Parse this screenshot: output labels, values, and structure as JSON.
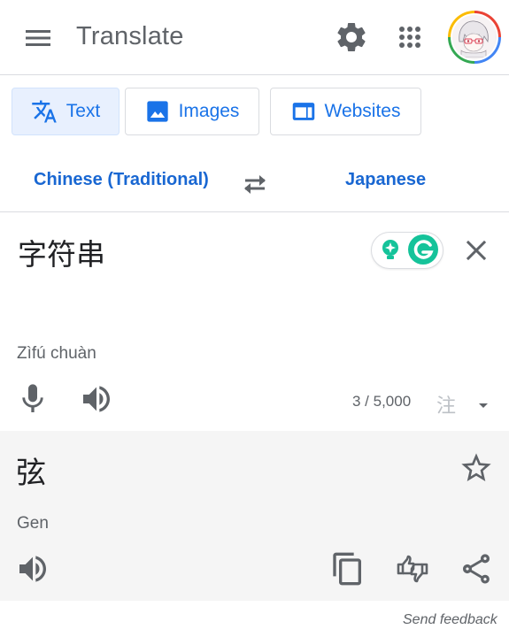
{
  "header": {
    "title": "Translate",
    "icons": {
      "menu": "menu-icon",
      "settings": "gear-icon",
      "apps": "apps-grid-icon",
      "avatar": "account-avatar"
    }
  },
  "modes": {
    "tabs": [
      {
        "label": "Text",
        "icon": "translate-icon",
        "active": true
      },
      {
        "label": "Images",
        "icon": "image-icon",
        "active": false
      },
      {
        "label": "Websites",
        "icon": "website-icon",
        "active": false
      }
    ]
  },
  "languages": {
    "source": "Chinese (Traditional)",
    "target": "Japanese",
    "swap_icon": "swap-icon"
  },
  "source": {
    "text": "字符串",
    "romanization": "Zìfú chuàn",
    "char_count": "3 / 5,000",
    "ime_label": "注"
  },
  "target": {
    "text": "弦",
    "romanization": "Gen"
  },
  "footer": {
    "feedback": "Send feedback"
  },
  "colors": {
    "accent": "#1a73e8",
    "active_tab_bg": "#e8f0fe",
    "icon_gray": "#5f6368",
    "grammarly_green": "#15c39a",
    "output_bg": "#f5f5f5"
  }
}
